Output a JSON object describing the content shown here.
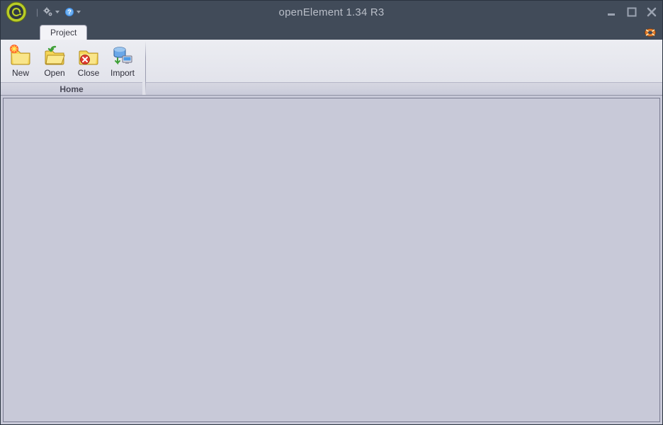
{
  "app": {
    "title": "openElement 1.34 R3"
  },
  "qat": {
    "separator": "|"
  },
  "tabs": {
    "project": "Project"
  },
  "ribbon": {
    "group_home_label": "Home",
    "buttons": {
      "new": "New",
      "open": "Open",
      "close": "Close",
      "import": "Import"
    }
  }
}
